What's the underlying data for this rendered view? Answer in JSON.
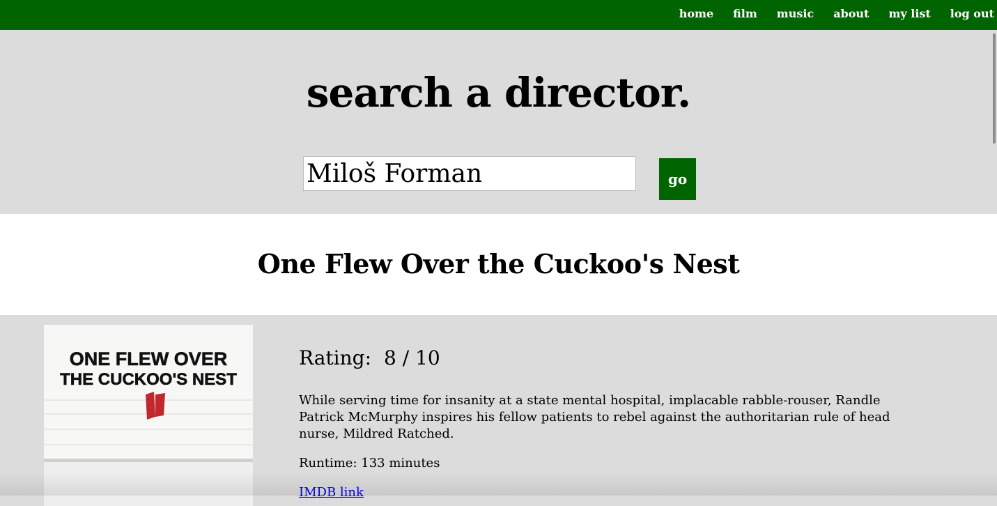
{
  "nav": {
    "items": [
      {
        "label": "home"
      },
      {
        "label": "film"
      },
      {
        "label": "music"
      },
      {
        "label": "about"
      },
      {
        "label": "my list"
      },
      {
        "label": "log out"
      }
    ],
    "background": "#006400"
  },
  "search": {
    "title": "search a director.",
    "input_value": "Miloš Forman",
    "button_label": "go"
  },
  "movie": {
    "title": "One Flew Over the Cuckoo's Nest",
    "rating_label": "Rating:",
    "rating_value": "8 / 10",
    "synopsis": "While serving time for insanity at a state mental hospital, implacable rabble-rouser, Randle Patrick McMurphy inspires his fellow patients to rebel against the authoritarian rule of head nurse, Mildred Ratched.",
    "runtime": "Runtime: 133 minutes",
    "imdb_link": "IMDB link",
    "poster": {
      "line1": "ONE FLEW OVER",
      "line2": "THE CUCKOO'S NEST"
    }
  }
}
